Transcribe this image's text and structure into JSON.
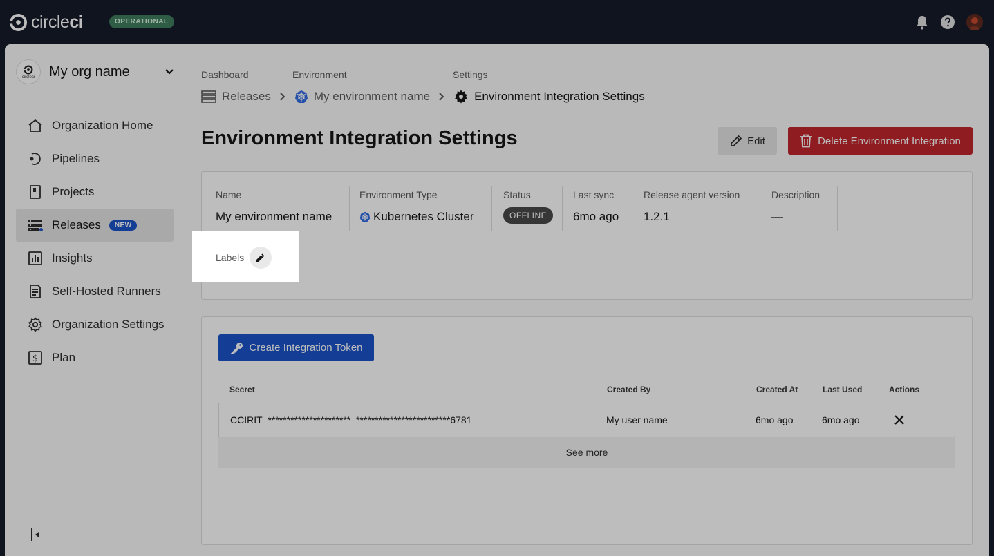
{
  "topbar": {
    "logo_text_light": "circle",
    "logo_text_bold": "ci",
    "status": "OPERATIONAL",
    "icons": [
      "bell-icon",
      "help-icon",
      "user-avatar"
    ]
  },
  "sidebar": {
    "org_name": "My org name",
    "org_avatar_text": "circleci",
    "items": [
      {
        "label": "Organization Home",
        "icon": "home-icon"
      },
      {
        "label": "Pipelines",
        "icon": "pipelines-icon"
      },
      {
        "label": "Projects",
        "icon": "projects-icon"
      },
      {
        "label": "Releases",
        "icon": "releases-icon",
        "badge": "NEW",
        "active": true
      },
      {
        "label": "Insights",
        "icon": "insights-icon"
      },
      {
        "label": "Self-Hosted Runners",
        "icon": "runners-icon"
      },
      {
        "label": "Organization Settings",
        "icon": "gear-icon"
      },
      {
        "label": "Plan",
        "icon": "plan-icon"
      }
    ]
  },
  "breadcrumb": {
    "labels": [
      "Dashboard",
      "Environment",
      "Settings"
    ],
    "items": [
      "Releases",
      "My environment name",
      "Environment Integration Settings"
    ]
  },
  "page": {
    "title": "Environment Integration Settings",
    "edit_label": "Edit",
    "delete_label": "Delete Environment Integration"
  },
  "details": {
    "fields": [
      {
        "label": "Name",
        "value": "My environment name"
      },
      {
        "label": "Environment Type",
        "value": "Kubernetes Cluster"
      },
      {
        "label": "Status",
        "value": "OFFLINE"
      },
      {
        "label": "Last sync",
        "value": "6mo ago"
      },
      {
        "label": "Release agent version",
        "value": "1.2.1"
      },
      {
        "label": "Description",
        "value": "—"
      }
    ],
    "labels_label": "Labels"
  },
  "tokens": {
    "create_label": "Create Integration Token",
    "columns": [
      "Secret",
      "Created By",
      "Created At",
      "Last Used",
      "Actions"
    ],
    "rows": [
      {
        "secret": "CCIRIT_**********************_*************************6781",
        "created_by": "My user name",
        "created_at": "6mo ago",
        "last_used": "6mo ago"
      }
    ],
    "see_more": "See more"
  },
  "colors": {
    "brand_blue": "#1b53c9",
    "danger": "#c1262d",
    "topbar": "#161c2b",
    "operational": "#3f7c5c"
  }
}
